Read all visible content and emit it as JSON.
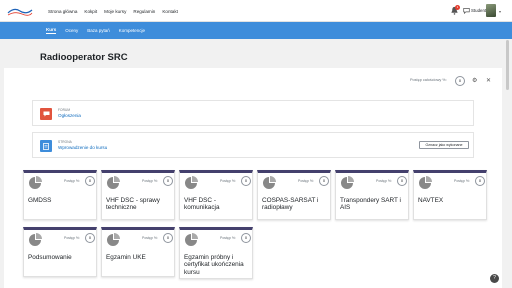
{
  "topnav": {
    "logo_text": "MORSKA",
    "items": [
      "Strona główna",
      "Kokpit",
      "Moje kursy",
      "Regulamin",
      "Kontakt"
    ],
    "notifications_count": "1",
    "user_name": "Student"
  },
  "subnav": {
    "items": [
      "Kurs",
      "Oceny",
      "Baza pytań",
      "Kompetencje"
    ]
  },
  "course": {
    "title": "Radiooperator SRC",
    "progress_label": "Postęp całościowy %:",
    "progress_value": "0"
  },
  "activities": [
    {
      "type": "FORUM",
      "name": "Ogłoszenia",
      "icon": "forum-icon",
      "color": "#e1543e"
    },
    {
      "type": "STRONA",
      "name": "Wprowadzenie do kursu",
      "icon": "page-icon",
      "color": "#3e8ddb",
      "button": "Oznacz jako wykonane"
    }
  ],
  "tiles": [
    {
      "title": "GMDSS",
      "progress_label": "Postęp %:",
      "progress": "0"
    },
    {
      "title": "VHF DSC - sprawy techniczne",
      "progress_label": "Postęp %:",
      "progress": "0"
    },
    {
      "title": "VHF DSC - komunikacja",
      "progress_label": "Postęp %:",
      "progress": "0"
    },
    {
      "title": "COSPAS-SARSAT i radiopławy",
      "progress_label": "Postęp %:",
      "progress": "0"
    },
    {
      "title": "Transpondery SART i AIS",
      "progress_label": "Postęp %:",
      "progress": "0"
    },
    {
      "title": "NAVTEX",
      "progress_label": "Postęp %:",
      "progress": "0"
    },
    {
      "title": "Podsumowanie",
      "progress_label": "Postęp %:",
      "progress": "0"
    },
    {
      "title": "Egzamin UKE",
      "progress_label": "Postęp %:",
      "progress": "0"
    },
    {
      "title": "Egzamin próbny i certyfikat ukończenia kursu",
      "progress_label": "Postęp %:",
      "progress": "0"
    }
  ],
  "colors": {
    "primary": "#3e8ddb",
    "tile_accent": "#44406d",
    "link": "#0f6cbf"
  }
}
